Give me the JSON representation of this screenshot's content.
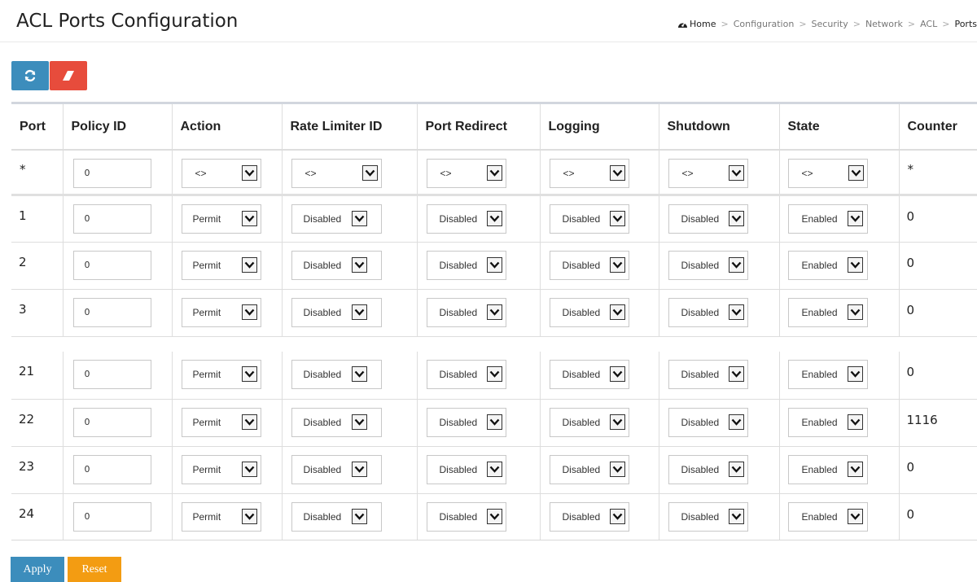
{
  "page": {
    "title": "ACL Ports Configuration"
  },
  "breadcrumb": {
    "home": "Home",
    "items": [
      "Configuration",
      "Security",
      "Network",
      "ACL"
    ],
    "current": "Ports"
  },
  "toolbar": {
    "refresh_icon": "refresh-icon",
    "clear_icon": "eraser-icon"
  },
  "colors": {
    "refresh_button": "#3c8dbc",
    "clear_button": "#e74c3c",
    "apply_button": "#3c8dbc",
    "reset_button": "#f39c12"
  },
  "table": {
    "headers": [
      "Port",
      "Policy ID",
      "Action",
      "Rate Limiter ID",
      "Port Redirect",
      "Logging",
      "Shutdown",
      "State",
      "Counter"
    ],
    "star_row": {
      "port": "*",
      "policy_id": "0",
      "action": "<>",
      "rate_limiter": "<>",
      "port_redirect": "<>",
      "logging": "<>",
      "shutdown": "<>",
      "state": "<>",
      "counter": "*"
    },
    "rows": [
      {
        "port": "1",
        "policy_id": "0",
        "action": "Permit",
        "rate_limiter": "Disabled",
        "port_redirect": "Disabled",
        "logging": "Disabled",
        "shutdown": "Disabled",
        "state": "Enabled",
        "counter": "0"
      },
      {
        "port": "2",
        "policy_id": "0",
        "action": "Permit",
        "rate_limiter": "Disabled",
        "port_redirect": "Disabled",
        "logging": "Disabled",
        "shutdown": "Disabled",
        "state": "Enabled",
        "counter": "0"
      },
      {
        "port": "3",
        "policy_id": "0",
        "action": "Permit",
        "rate_limiter": "Disabled",
        "port_redirect": "Disabled",
        "logging": "Disabled",
        "shutdown": "Disabled",
        "state": "Enabled",
        "counter": "0"
      },
      {
        "port": "21",
        "policy_id": "0",
        "action": "Permit",
        "rate_limiter": "Disabled",
        "port_redirect": "Disabled",
        "logging": "Disabled",
        "shutdown": "Disabled",
        "state": "Enabled",
        "counter": "0"
      },
      {
        "port": "22",
        "policy_id": "0",
        "action": "Permit",
        "rate_limiter": "Disabled",
        "port_redirect": "Disabled",
        "logging": "Disabled",
        "shutdown": "Disabled",
        "state": "Enabled",
        "counter": "1116"
      },
      {
        "port": "23",
        "policy_id": "0",
        "action": "Permit",
        "rate_limiter": "Disabled",
        "port_redirect": "Disabled",
        "logging": "Disabled",
        "shutdown": "Disabled",
        "state": "Enabled",
        "counter": "0"
      },
      {
        "port": "24",
        "policy_id": "0",
        "action": "Permit",
        "rate_limiter": "Disabled",
        "port_redirect": "Disabled",
        "logging": "Disabled",
        "shutdown": "Disabled",
        "state": "Enabled",
        "counter": "0"
      }
    ]
  },
  "buttons": {
    "apply": "Apply",
    "reset": "Reset"
  }
}
